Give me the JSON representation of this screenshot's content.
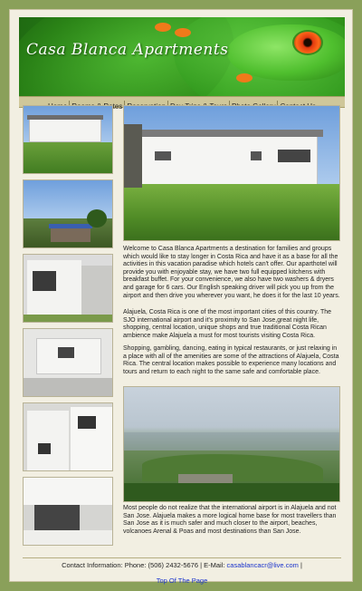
{
  "header": {
    "title": "Casa Blanca Apartments"
  },
  "nav": {
    "items": [
      "Home",
      "Rooms & Rates",
      "Reservation",
      "Day Trips & Tours",
      "Photo Gallery",
      "Contact Us"
    ]
  },
  "content": {
    "paragraphs": [
      "Welcome to Casa Blanca Apartments a destination for families and groups which would like to stay longer in Costa Rica and have it as a base for all the activities in this vacation paradise which hotels can't offer. Our aparthotel will provide you with enjoyable stay, we have two full equipped kitchens with breakfast buffet. For your convenience, we also have two washers & dryers and garage for 6 cars. Our English speaking driver will pick you up from the airport and then drive you wherever you want, he does it for the last 10 years.",
      "Alajuela, Costa Rica is one of the most important cities of this country. The SJO international airport and it's proximity to San Jose,great night life, shopping, central location, unique shops and true traditional Costa Rican ambience make Alajuela a must for most tourists visiting Costa Rica.",
      "Shopping, gambling, dancing, eating in typical restaurants, or just relaxing in a place with all of the amenities are some of the attractions of Alajuela, Costa Rica. The central location makes possible to experience many locations and tours and return to each night to the same safe and comfortable place.",
      "Most people do not realize that the international airport is in Alajuela and not San Jose. Alajuela makes a more logical home base for most travellers than San Jose as it is much safer and much closer to the airport, beaches, volcanoes Arenal & Poas and most destinations than San Jose."
    ]
  },
  "footer": {
    "contact_prefix": "Contact Information: Phone: (506) 2432-5676 | E-Mail: ",
    "email": "casablancacr@live.com",
    "contact_suffix": " |",
    "top_link": "Top Of The Page"
  },
  "colors": {
    "background": "#8aa05a",
    "page": "#f2efe2",
    "nav": "#cfc79a",
    "link": "#1a33cc"
  }
}
